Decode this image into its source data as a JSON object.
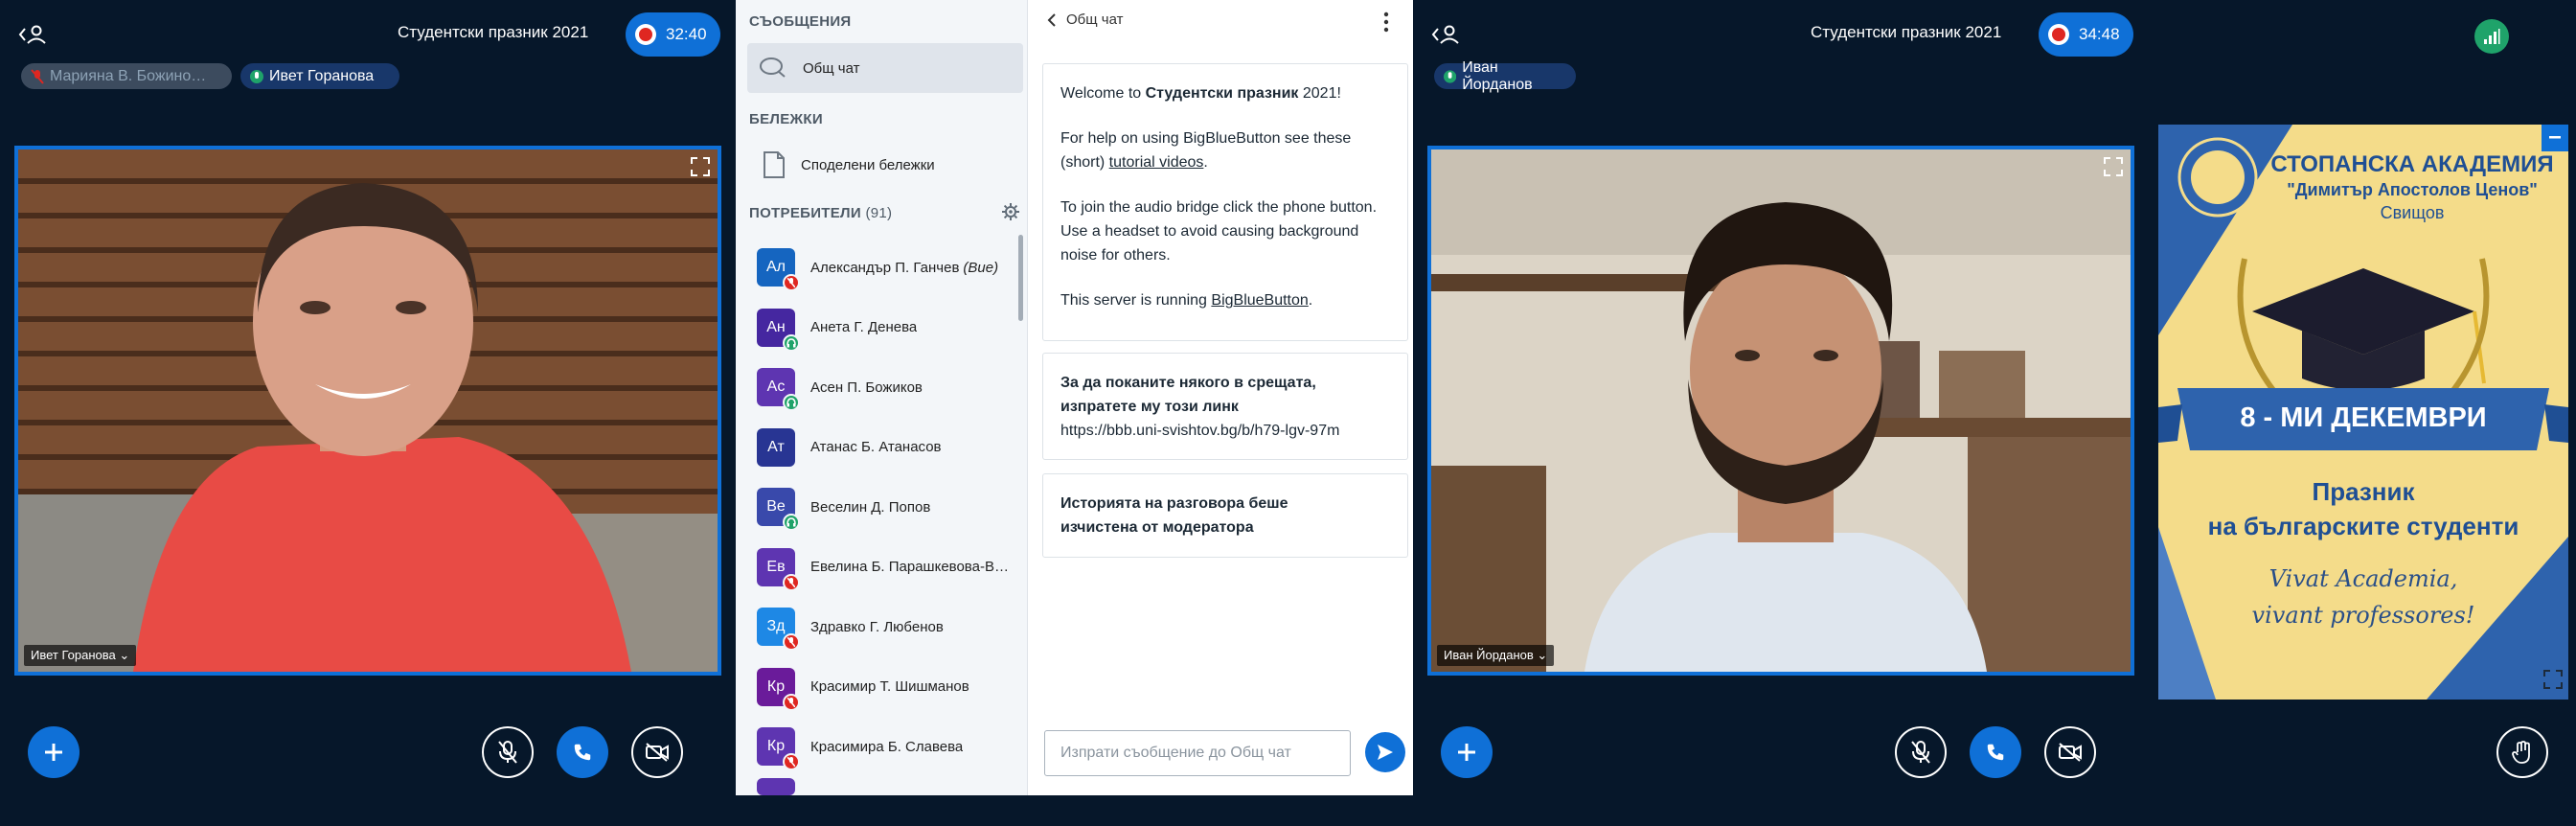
{
  "left_panel": {
    "title": "Студентски празник 2021",
    "timer": "32:40",
    "talkers": [
      {
        "name": "Марияна В. Божино…",
        "muted": true
      },
      {
        "name": "Ивет Горанова",
        "muted": false
      }
    ],
    "video_label": "Ивет Горанова"
  },
  "sidebar": {
    "messages_heading": "СЪОБЩЕНИЯ",
    "public_chat_label": "Общ чат",
    "notes_heading": "БЕЛЕЖКИ",
    "shared_notes_label": "Споделени бележки",
    "users_heading": "ПОТРЕБИТЕЛИ",
    "users_count": "(91)",
    "users": [
      {
        "initials": "Ал",
        "name": "Александър П. Ганчев",
        "suffix": "(Вие)",
        "color": "#1565c0",
        "badge": "muted"
      },
      {
        "initials": "Ан",
        "name": "Анета Г. Денева",
        "suffix": "",
        "color": "#4527a0",
        "badge": "listen"
      },
      {
        "initials": "Ас",
        "name": "Асен П. Божиков",
        "suffix": "",
        "color": "#5e35b1",
        "badge": "listen"
      },
      {
        "initials": "Ат",
        "name": "Атанас Б. Атанасов",
        "suffix": "",
        "color": "#283593",
        "badge": "none"
      },
      {
        "initials": "Ве",
        "name": "Веселин Д. Попов",
        "suffix": "",
        "color": "#3949ab",
        "badge": "listen"
      },
      {
        "initials": "Ев",
        "name": "Евелина Б. Парашкевова-В…",
        "suffix": "",
        "color": "#5e35b1",
        "badge": "muted"
      },
      {
        "initials": "Зд",
        "name": "Здравко Г. Любенов",
        "suffix": "",
        "color": "#1e88e5",
        "badge": "muted"
      },
      {
        "initials": "Кр",
        "name": "Красимир Т. Шишманов",
        "suffix": "",
        "color": "#6a1b9a",
        "badge": "muted"
      },
      {
        "initials": "Кр",
        "name": "Красимира Б. Славева",
        "suffix": "",
        "color": "#5e35b1",
        "badge": "muted"
      }
    ]
  },
  "chat": {
    "header": "Общ чат",
    "welcome_prefix": "Welcome to ",
    "welcome_bold": "Студентски празник",
    "welcome_suffix": " 2021!",
    "help_text": "For help on using BigBlueButton see these (short) ",
    "help_link": "tutorial videos",
    "help_end": ".",
    "audio_text": "To join the audio bridge click the phone button. Use a headset to avoid causing background noise for others.",
    "server_prefix": "This server is running ",
    "server_link": "BigBlueButton",
    "server_end": ".",
    "invite_line1": "За да поканите някого в срещата,",
    "invite_line2": "изпратете му този линк",
    "invite_link": "https://bbb.uni-svishtov.bg/b/h79-lgv-97m",
    "cleared_line1": "Историята на разговора беше",
    "cleared_line2": "изчистена от модератора",
    "input_placeholder": "Изпрати съобщение до Общ чат"
  },
  "right_panel": {
    "title": "Студентски празник 2021",
    "timer": "34:48",
    "talker": "Иван Йорданов",
    "video_label": "Иван Йорданов",
    "poster": {
      "academy": "СТОПАНСКА АКАДЕМИЯ",
      "name": "\"Димитър Апостолов Ценов\"",
      "city": "Свищов",
      "date": "8 - МИ ДЕКЕМВРИ",
      "holiday1": "Празник",
      "holiday2": "на българските студенти",
      "motto1": "Vivat Academia,",
      "motto2": "vivant professores!"
    }
  },
  "colors": {
    "accent": "#0f70d7",
    "background": "#06172a",
    "recording": "#df2721"
  }
}
